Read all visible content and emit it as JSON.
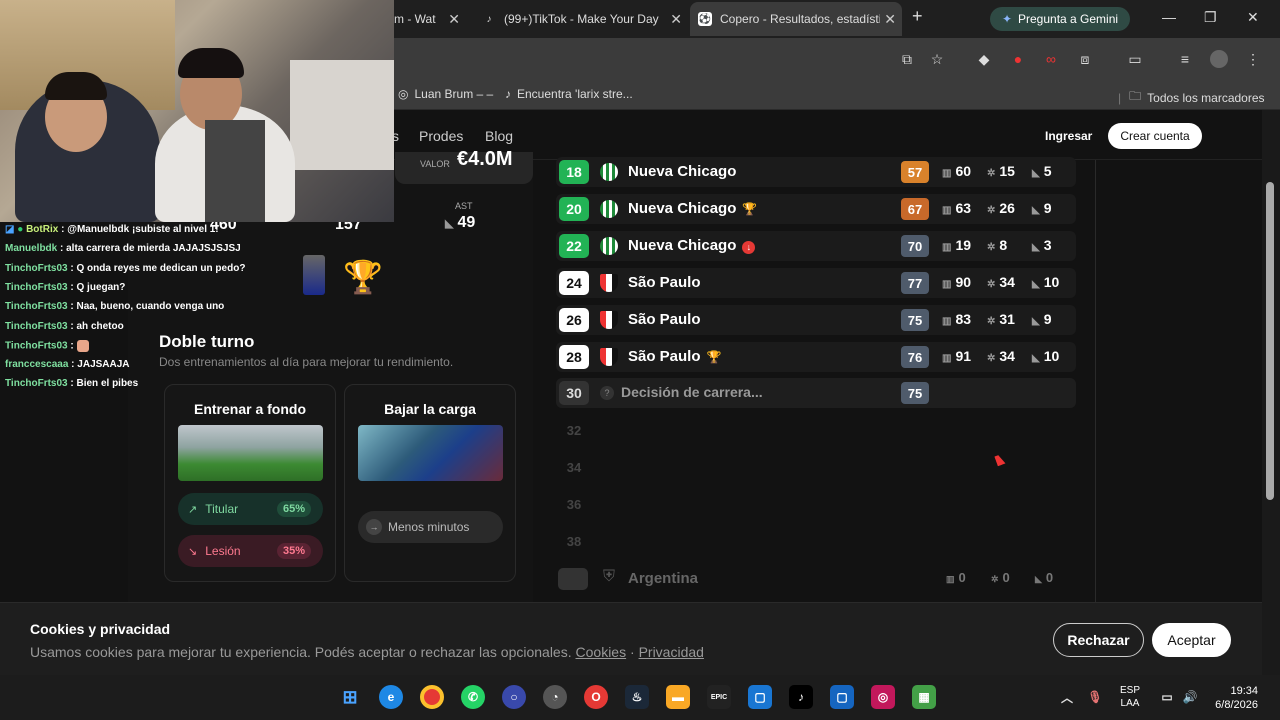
{
  "browser": {
    "tabs": [
      {
        "label": "m - Wat",
        "icon": "youtube"
      },
      {
        "label": "(99+)TikTok - Make Your Day",
        "icon": "tiktok"
      },
      {
        "label": "Copero - Resultados, estadísti",
        "icon": "copero"
      }
    ],
    "gemini_label": "Pregunta a Gemini",
    "bookmarks": [
      {
        "label": "Luan Brum – –"
      },
      {
        "label": "Encuentra 'larix stre..."
      }
    ],
    "all_bookmarks": "Todos los marcadores"
  },
  "nav": {
    "links": [
      "s",
      "Prodes",
      "Blog"
    ],
    "login": "Ingresar",
    "signup": "Crear cuenta"
  },
  "left": {
    "valor_label": "VALOR",
    "valor_value": "€4.0M",
    "ast_label": "AST",
    "ast_value": "49",
    "partial_values": [
      "460",
      "157"
    ]
  },
  "doble_turno": {
    "title": "Doble turno",
    "subtitle": "Dos entrenamientos al día para mejorar tu rendimiento.",
    "card1": {
      "title": "Entrenar a fondo",
      "option1_label": "Titular",
      "option1_pct": "65%",
      "option2_label": "Lesión",
      "option2_pct": "35%"
    },
    "card2": {
      "title": "Bajar la carga",
      "option1_label": "Menos minutos"
    }
  },
  "career": {
    "rows": [
      {
        "age": "18",
        "club": "Nueva Chicago",
        "ovr": "57",
        "ovr_color": "#d9822b",
        "pj": "60",
        "g": "15",
        "a": "5",
        "badge": ""
      },
      {
        "age": "20",
        "club": "Nueva Chicago",
        "ovr": "67",
        "ovr_color": "#c8692a",
        "pj": "63",
        "g": "26",
        "a": "9",
        "badge": "trophy"
      },
      {
        "age": "22",
        "club": "Nueva Chicago",
        "ovr": "70",
        "ovr_color": "#4f5b6b",
        "pj": "19",
        "g": "8",
        "a": "3",
        "badge": "down"
      },
      {
        "age": "24",
        "club": "São Paulo",
        "ovr": "77",
        "ovr_color": "#4f5b6b",
        "pj": "90",
        "g": "34",
        "a": "10",
        "badge": ""
      },
      {
        "age": "26",
        "club": "São Paulo",
        "ovr": "75",
        "ovr_color": "#4f5b6b",
        "pj": "83",
        "g": "31",
        "a": "9",
        "badge": ""
      },
      {
        "age": "28",
        "club": "São Paulo",
        "ovr": "76",
        "ovr_color": "#4f5b6b",
        "pj": "91",
        "g": "34",
        "a": "10",
        "badge": "trophy"
      }
    ],
    "pending": {
      "age": "30",
      "label": "Decisión de carrera...",
      "ovr": "75"
    },
    "future_ages": [
      "32",
      "34",
      "36",
      "38"
    ],
    "national": {
      "label": "Argentina",
      "pj": "0",
      "g": "0",
      "a": "0"
    }
  },
  "cookie": {
    "title": "Cookies y privacidad",
    "text": "Usamos cookies para mejorar tu experiencia. Podés aceptar o rechazar las opcionales.",
    "link_cookies": "Cookies",
    "separator": "·",
    "link_privacy": "Privacidad",
    "reject": "Rechazar",
    "accept": "Aceptar"
  },
  "chat": [
    {
      "user": "BotRix",
      "text": "@Manuelbdk ¡subiste al nivel 1!"
    },
    {
      "user": "Manuelbdk",
      "text": "alta carrera de mierda JAJAJSJSJSJ"
    },
    {
      "user": "TinchoFrts03",
      "text": "Q onda reyes me dedican un pedo?"
    },
    {
      "user": "TinchoFrts03",
      "text": "Q juegan?"
    },
    {
      "user": "TinchoFrts03",
      "text": "Naa, bueno, cuando venga uno"
    },
    {
      "user": "TinchoFrts03",
      "text": "ah chetoo"
    },
    {
      "user": "TinchoFrts03",
      "text": ""
    },
    {
      "user": "franccescaaa",
      "text": "JAJSAAJA"
    },
    {
      "user": "TinchoFrts03",
      "text": "Bien el pibes"
    }
  ],
  "taskbar": {
    "lang_line1": "ESP",
    "lang_line2": "LAA",
    "time": "19:34",
    "date": "6/8/2026"
  }
}
